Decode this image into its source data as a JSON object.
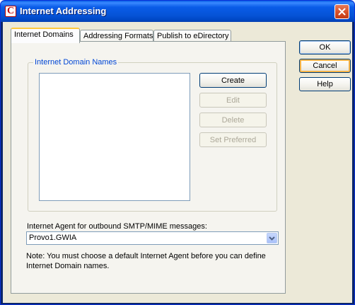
{
  "window": {
    "title": "Internet Addressing",
    "app_icon_letter": "C"
  },
  "tabs": [
    {
      "label": "Internet Domains",
      "active": true
    },
    {
      "label": "Addressing Formats",
      "active": false
    },
    {
      "label": "Publish to eDirectory",
      "active": false
    }
  ],
  "domains_group": {
    "title": "Internet Domain Names",
    "items": [],
    "buttons": {
      "create": "Create",
      "edit": "Edit",
      "delete": "Delete",
      "set_preferred": "Set Preferred"
    }
  },
  "agent": {
    "label": "Internet Agent for outbound SMTP/MIME messages:",
    "value": "Provo1.GWIA"
  },
  "note": "Note:  You must choose a default Internet Agent before you can define Internet Domain names.",
  "dialog_buttons": {
    "ok": "OK",
    "cancel": "Cancel",
    "help": "Help"
  },
  "colors": {
    "titlebar": "#0553d6",
    "group_title": "#0046d5",
    "close_button": "#d9532c",
    "face": "#ece9d8"
  },
  "icons": {
    "close": "close-x-icon",
    "dropdown": "chevron-down-icon",
    "app": "novell-app-icon"
  }
}
